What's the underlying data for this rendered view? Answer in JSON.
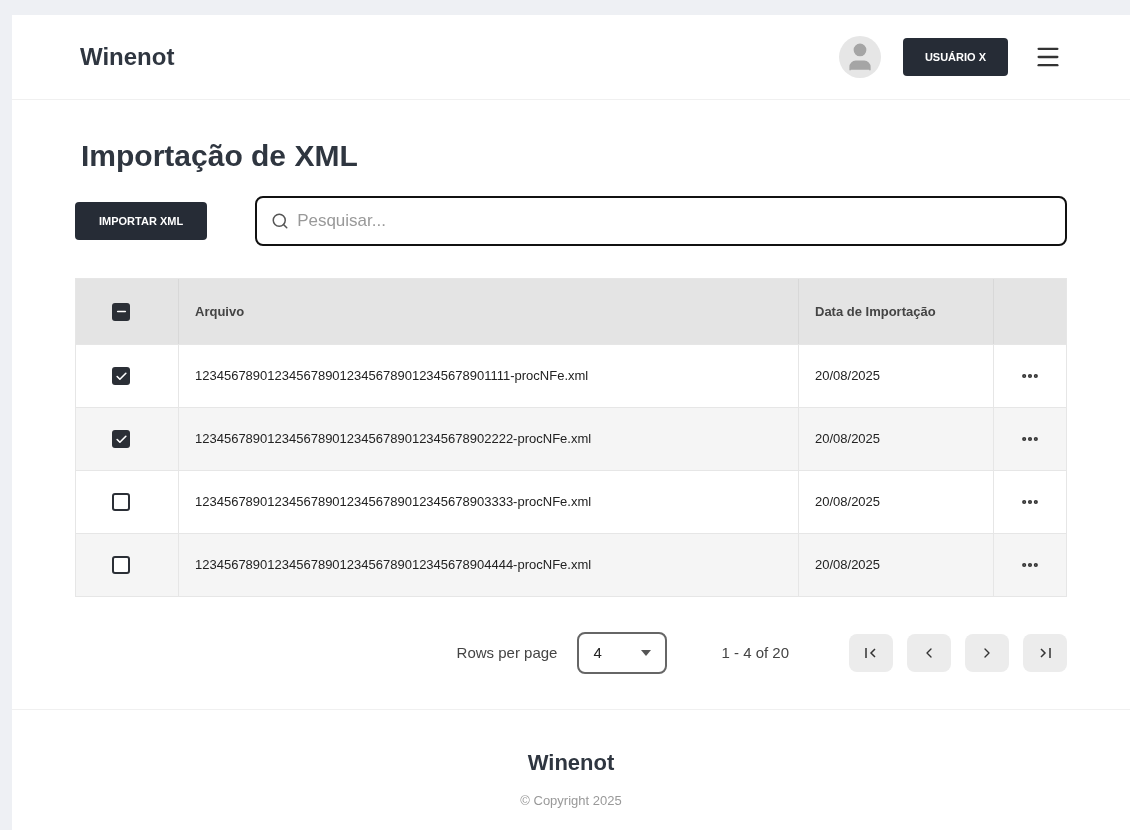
{
  "header": {
    "brand": "Winenot",
    "user_button": "USUÁRIO X"
  },
  "page": {
    "title": "Importação de XML",
    "import_button": "IMPORTAR XML",
    "search": {
      "placeholder": "Pesquisar..."
    }
  },
  "table": {
    "select_all": {
      "indeterminate": true
    },
    "columns": [
      "Arquivo",
      "Data de Importação"
    ],
    "rows": [
      {
        "checked": true,
        "file": "12345678901234567890123456789012345678901111-procNFe.xml",
        "date": "20/08/2025"
      },
      {
        "checked": true,
        "file": "12345678901234567890123456789012345678902222-procNFe.xml",
        "date": "20/08/2025"
      },
      {
        "checked": false,
        "file": "12345678901234567890123456789012345678903333-procNFe.xml",
        "date": "20/08/2025"
      },
      {
        "checked": false,
        "file": "12345678901234567890123456789012345678904444-procNFe.xml",
        "date": "20/08/2025"
      }
    ]
  },
  "pagination": {
    "rows_label": "Rows per page",
    "rows_value": "4",
    "range": "1 - 4 of 20"
  },
  "footer": {
    "brand": "Winenot",
    "copyright": "© Copyright 2025"
  }
}
